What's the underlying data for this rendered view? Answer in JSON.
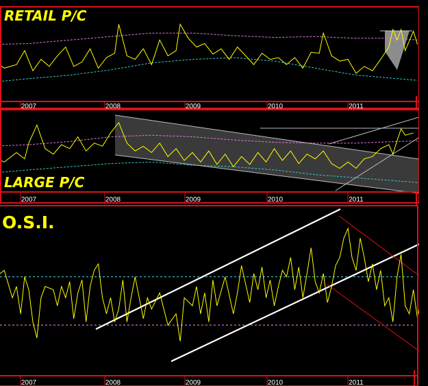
{
  "colors": {
    "background": "#000000",
    "series": "#ffff00",
    "frame": "#e0101a",
    "upper_band": "#e07be0",
    "lower_band": "#33cccc",
    "trendline": "#ffffff",
    "down_channel": "#e0101a",
    "shade": "#8c8c8c"
  },
  "chart_data": [
    {
      "type": "line",
      "title": "RETAIL P/C",
      "x_tick_labels": [
        "2007",
        "2008",
        "2009",
        "2010",
        "2011"
      ],
      "x_range": [
        2006.55,
        2011.85
      ],
      "ylim": [
        0,
        100
      ],
      "grid": false,
      "series_points": [
        [
          2006.55,
          48
        ],
        [
          2006.7,
          38
        ],
        [
          2006.85,
          42
        ],
        [
          2006.95,
          58
        ],
        [
          2007.05,
          35
        ],
        [
          2007.15,
          48
        ],
        [
          2007.25,
          40
        ],
        [
          2007.35,
          52
        ],
        [
          2007.45,
          62
        ],
        [
          2007.55,
          40
        ],
        [
          2007.65,
          45
        ],
        [
          2007.75,
          60
        ],
        [
          2007.85,
          38
        ],
        [
          2007.95,
          50
        ],
        [
          2008.05,
          55
        ],
        [
          2008.1,
          88
        ],
        [
          2008.2,
          52
        ],
        [
          2008.3,
          48
        ],
        [
          2008.4,
          60
        ],
        [
          2008.5,
          42
        ],
        [
          2008.6,
          70
        ],
        [
          2008.7,
          52
        ],
        [
          2008.8,
          58
        ],
        [
          2008.85,
          88
        ],
        [
          2008.95,
          72
        ],
        [
          2009.05,
          62
        ],
        [
          2009.15,
          66
        ],
        [
          2009.25,
          54
        ],
        [
          2009.35,
          60
        ],
        [
          2009.45,
          48
        ],
        [
          2009.55,
          62
        ],
        [
          2009.65,
          52
        ],
        [
          2009.75,
          42
        ],
        [
          2009.85,
          55
        ],
        [
          2009.95,
          48
        ],
        [
          2010.05,
          50
        ],
        [
          2010.15,
          42
        ],
        [
          2010.25,
          50
        ],
        [
          2010.35,
          38
        ],
        [
          2010.45,
          56
        ],
        [
          2010.55,
          55
        ],
        [
          2010.6,
          78
        ],
        [
          2010.7,
          52
        ],
        [
          2010.8,
          46
        ],
        [
          2010.9,
          48
        ],
        [
          2011.0,
          32
        ],
        [
          2011.1,
          40
        ],
        [
          2011.2,
          35
        ],
        [
          2011.3,
          48
        ],
        [
          2011.4,
          62
        ],
        [
          2011.45,
          82
        ],
        [
          2011.5,
          70
        ],
        [
          2011.55,
          82
        ],
        [
          2011.6,
          58
        ],
        [
          2011.7,
          80
        ],
        [
          2011.75,
          65
        ]
      ],
      "upper_band_points": [
        [
          2006.55,
          65
        ],
        [
          2007.0,
          66
        ],
        [
          2007.5,
          70
        ],
        [
          2008.0,
          74
        ],
        [
          2008.5,
          78
        ],
        [
          2009.0,
          78
        ],
        [
          2009.5,
          75
        ],
        [
          2010.0,
          73
        ],
        [
          2010.5,
          74
        ],
        [
          2011.0,
          72
        ],
        [
          2011.5,
          72
        ],
        [
          2011.75,
          70
        ]
      ],
      "lower_band_points": [
        [
          2006.55,
          22
        ],
        [
          2007.0,
          26
        ],
        [
          2007.5,
          30
        ],
        [
          2008.0,
          36
        ],
        [
          2008.5,
          44
        ],
        [
          2009.0,
          48
        ],
        [
          2009.5,
          50
        ],
        [
          2010.0,
          46
        ],
        [
          2010.5,
          38
        ],
        [
          2011.0,
          30
        ],
        [
          2011.5,
          26
        ],
        [
          2011.75,
          24
        ]
      ],
      "shaded_region": [
        2011.45,
        2011.7
      ]
    },
    {
      "type": "line",
      "title": "LARGE P/C",
      "x_tick_labels": [
        "2007",
        "2008",
        "2009",
        "2010",
        "2011"
      ],
      "x_range": [
        2006.55,
        2011.85
      ],
      "ylim": [
        0,
        100
      ],
      "grid": false,
      "series_points": [
        [
          2006.55,
          45
        ],
        [
          2006.7,
          38
        ],
        [
          2006.85,
          50
        ],
        [
          2006.95,
          42
        ],
        [
          2007.0,
          62
        ],
        [
          2007.1,
          85
        ],
        [
          2007.2,
          55
        ],
        [
          2007.3,
          48
        ],
        [
          2007.4,
          60
        ],
        [
          2007.5,
          55
        ],
        [
          2007.6,
          70
        ],
        [
          2007.7,
          52
        ],
        [
          2007.8,
          62
        ],
        [
          2007.9,
          58
        ],
        [
          2008.0,
          75
        ],
        [
          2008.1,
          88
        ],
        [
          2008.2,
          62
        ],
        [
          2008.3,
          52
        ],
        [
          2008.4,
          58
        ],
        [
          2008.5,
          50
        ],
        [
          2008.6,
          62
        ],
        [
          2008.7,
          45
        ],
        [
          2008.8,
          55
        ],
        [
          2008.9,
          40
        ],
        [
          2009.0,
          50
        ],
        [
          2009.1,
          38
        ],
        [
          2009.2,
          52
        ],
        [
          2009.3,
          35
        ],
        [
          2009.4,
          48
        ],
        [
          2009.5,
          32
        ],
        [
          2009.6,
          45
        ],
        [
          2009.7,
          35
        ],
        [
          2009.8,
          50
        ],
        [
          2009.9,
          38
        ],
        [
          2010.0,
          55
        ],
        [
          2010.1,
          40
        ],
        [
          2010.2,
          52
        ],
        [
          2010.3,
          36
        ],
        [
          2010.4,
          48
        ],
        [
          2010.5,
          42
        ],
        [
          2010.6,
          52
        ],
        [
          2010.7,
          36
        ],
        [
          2010.8,
          30
        ],
        [
          2010.9,
          38
        ],
        [
          2011.0,
          30
        ],
        [
          2011.1,
          42
        ],
        [
          2011.2,
          45
        ],
        [
          2011.3,
          55
        ],
        [
          2011.4,
          60
        ],
        [
          2011.45,
          48
        ],
        [
          2011.5,
          65
        ],
        [
          2011.55,
          80
        ],
        [
          2011.6,
          72
        ],
        [
          2011.7,
          75
        ]
      ],
      "upper_band_points": [
        [
          2006.55,
          58
        ],
        [
          2007.0,
          60
        ],
        [
          2007.5,
          64
        ],
        [
          2008.0,
          70
        ],
        [
          2008.5,
          72
        ],
        [
          2009.0,
          70
        ],
        [
          2009.5,
          66
        ],
        [
          2010.0,
          63
        ],
        [
          2010.5,
          62
        ],
        [
          2011.0,
          62
        ],
        [
          2011.5,
          64
        ],
        [
          2011.75,
          65
        ]
      ],
      "lower_band_points": [
        [
          2006.55,
          24
        ],
        [
          2007.0,
          28
        ],
        [
          2007.5,
          32
        ],
        [
          2008.0,
          36
        ],
        [
          2008.5,
          38
        ],
        [
          2009.0,
          34
        ],
        [
          2009.5,
          32
        ],
        [
          2010.0,
          28
        ],
        [
          2010.5,
          22
        ],
        [
          2011.0,
          18
        ],
        [
          2011.5,
          14
        ],
        [
          2011.75,
          12
        ]
      ],
      "shaded_region": [
        2008.05,
        2011.85
      ]
    },
    {
      "type": "line",
      "title": "O.S.I.",
      "x_tick_labels": [
        "2007",
        "2008",
        "2009",
        "2010",
        "2011"
      ],
      "x_range": [
        2006.55,
        2011.85
      ],
      "ylim": [
        0,
        100
      ],
      "grid": false,
      "upper_reference": 58,
      "lower_reference": 28,
      "series_points": [
        [
          2006.55,
          50
        ],
        [
          2006.6,
          58
        ],
        [
          2006.7,
          62
        ],
        [
          2006.8,
          45
        ],
        [
          2006.85,
          52
        ],
        [
          2006.9,
          35
        ],
        [
          2006.95,
          58
        ],
        [
          2007.0,
          50
        ],
        [
          2007.05,
          30
        ],
        [
          2007.1,
          20
        ],
        [
          2007.15,
          45
        ],
        [
          2007.2,
          52
        ],
        [
          2007.3,
          50
        ],
        [
          2007.35,
          40
        ],
        [
          2007.4,
          52
        ],
        [
          2007.45,
          45
        ],
        [
          2007.5,
          55
        ],
        [
          2007.55,
          32
        ],
        [
          2007.6,
          48
        ],
        [
          2007.65,
          56
        ],
        [
          2007.7,
          30
        ],
        [
          2007.75,
          52
        ],
        [
          2007.8,
          62
        ],
        [
          2007.85,
          66
        ],
        [
          2007.9,
          45
        ],
        [
          2007.95,
          35
        ],
        [
          2008.0,
          45
        ],
        [
          2008.05,
          30
        ],
        [
          2008.1,
          38
        ],
        [
          2008.15,
          56
        ],
        [
          2008.2,
          30
        ],
        [
          2008.25,
          45
        ],
        [
          2008.3,
          58
        ],
        [
          2008.4,
          32
        ],
        [
          2008.45,
          45
        ],
        [
          2008.5,
          38
        ],
        [
          2008.6,
          48
        ],
        [
          2008.7,
          28
        ],
        [
          2008.8,
          35
        ],
        [
          2008.85,
          18
        ],
        [
          2008.9,
          45
        ],
        [
          2009.0,
          40
        ],
        [
          2009.05,
          52
        ],
        [
          2009.1,
          35
        ],
        [
          2009.15,
          48
        ],
        [
          2009.2,
          30
        ],
        [
          2009.25,
          56
        ],
        [
          2009.3,
          40
        ],
        [
          2009.4,
          58
        ],
        [
          2009.5,
          35
        ],
        [
          2009.55,
          48
        ],
        [
          2009.6,
          65
        ],
        [
          2009.7,
          42
        ],
        [
          2009.75,
          60
        ],
        [
          2009.8,
          50
        ],
        [
          2009.85,
          64
        ],
        [
          2009.9,
          45
        ],
        [
          2009.95,
          56
        ],
        [
          2010.0,
          40
        ],
        [
          2010.05,
          52
        ],
        [
          2010.1,
          62
        ],
        [
          2010.15,
          58
        ],
        [
          2010.2,
          70
        ],
        [
          2010.25,
          50
        ],
        [
          2010.3,
          64
        ],
        [
          2010.35,
          45
        ],
        [
          2010.4,
          60
        ],
        [
          2010.45,
          76
        ],
        [
          2010.5,
          55
        ],
        [
          2010.55,
          48
        ],
        [
          2010.6,
          60
        ],
        [
          2010.65,
          42
        ],
        [
          2010.7,
          52
        ],
        [
          2010.75,
          65
        ],
        [
          2010.8,
          70
        ],
        [
          2010.85,
          82
        ],
        [
          2010.9,
          88
        ],
        [
          2010.95,
          70
        ],
        [
          2011.0,
          62
        ],
        [
          2011.05,
          82
        ],
        [
          2011.1,
          70
        ],
        [
          2011.15,
          55
        ],
        [
          2011.2,
          66
        ],
        [
          2011.25,
          50
        ],
        [
          2011.3,
          62
        ],
        [
          2011.35,
          40
        ],
        [
          2011.4,
          45
        ],
        [
          2011.45,
          30
        ],
        [
          2011.5,
          58
        ],
        [
          2011.55,
          72
        ],
        [
          2011.6,
          40
        ],
        [
          2011.65,
          35
        ],
        [
          2011.7,
          50
        ],
        [
          2011.75,
          32
        ],
        [
          2011.8,
          45
        ]
      ]
    }
  ]
}
